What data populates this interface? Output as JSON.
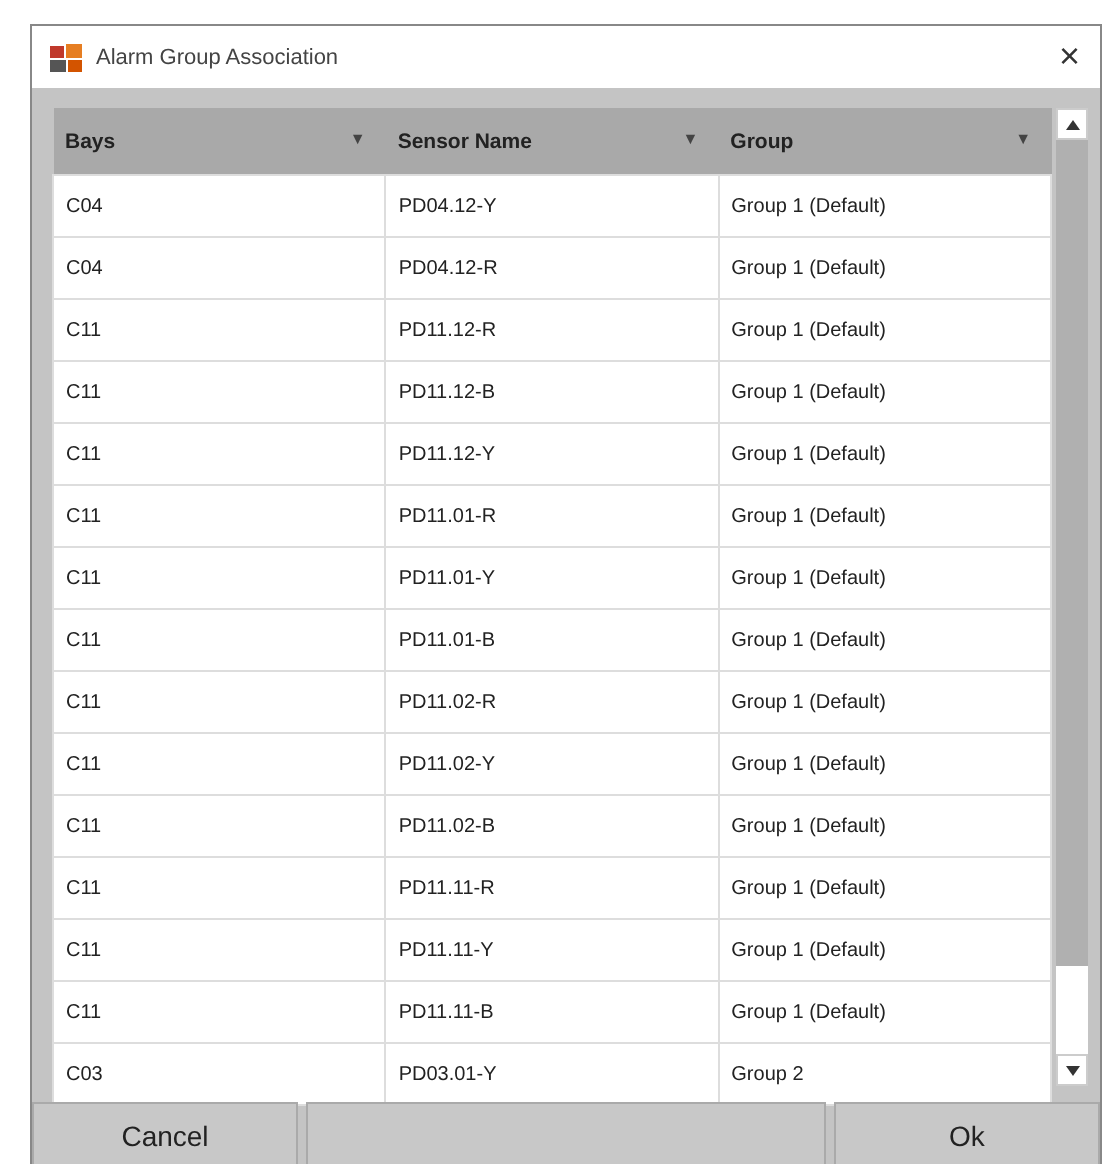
{
  "window": {
    "title": "Alarm Group Association",
    "close": "×"
  },
  "table": {
    "columns": [
      {
        "label": "Bays",
        "filter": "▼"
      },
      {
        "label": "Sensor Name",
        "filter": "▼"
      },
      {
        "label": "Group",
        "filter": "▼"
      }
    ],
    "rows": [
      [
        "C04",
        "PD04.12-Y",
        "Group 1 (Default)"
      ],
      [
        "C04",
        "PD04.12-R",
        "Group 1 (Default)"
      ],
      [
        "C11",
        "PD11.12-R",
        "Group 1 (Default)"
      ],
      [
        "C11",
        "PD11.12-B",
        "Group 1 (Default)"
      ],
      [
        "C11",
        "PD11.12-Y",
        "Group 1 (Default)"
      ],
      [
        "C11",
        "PD11.01-R",
        "Group 1 (Default)"
      ],
      [
        "C11",
        "PD11.01-Y",
        "Group 1 (Default)"
      ],
      [
        "C11",
        "PD11.01-B",
        "Group 1 (Default)"
      ],
      [
        "C11",
        "PD11.02-R",
        "Group 1 (Default)"
      ],
      [
        "C11",
        "PD11.02-Y",
        "Group 1 (Default)"
      ],
      [
        "C11",
        "PD11.02-B",
        "Group 1 (Default)"
      ],
      [
        "C11",
        "PD11.11-R",
        "Group 1 (Default)"
      ],
      [
        "C11",
        "PD11.11-Y",
        "Group 1 (Default)"
      ],
      [
        "C11",
        "PD11.11-B",
        "Group 1 (Default)"
      ],
      [
        "C03",
        "PD03.01-Y",
        "Group 2"
      ]
    ]
  },
  "buttons": [
    {
      "label": "Cancel"
    },
    {
      "label": "Ok"
    }
  ]
}
